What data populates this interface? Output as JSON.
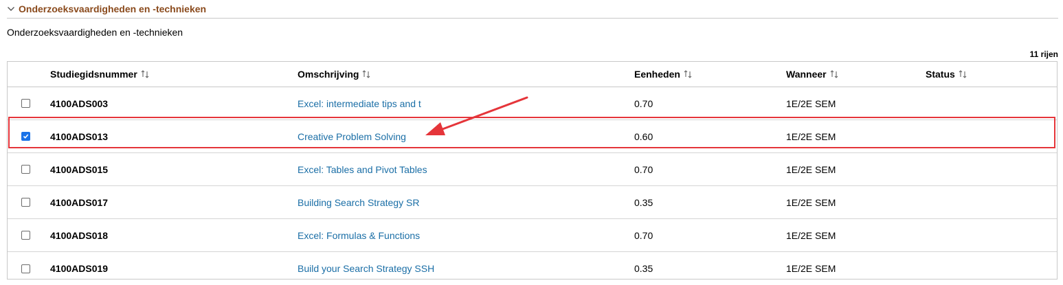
{
  "section": {
    "title": "Onderzoeksvaardigheden en -technieken",
    "subtitle": "Onderzoeksvaardigheden en -technieken"
  },
  "row_count": "11 rijen",
  "columns": {
    "id": "Studiegidsnummer",
    "description": "Omschrijving",
    "units": "Eenheden",
    "when": "Wanneer",
    "status": "Status"
  },
  "rows": [
    {
      "checked": false,
      "id": "4100ADS003",
      "description": "Excel: intermediate tips and t",
      "units": "0.70",
      "when": "1E/2E SEM",
      "status": ""
    },
    {
      "checked": true,
      "id": "4100ADS013",
      "description": "Creative Problem Solving",
      "units": "0.60",
      "when": "1E/2E SEM",
      "status": ""
    },
    {
      "checked": false,
      "id": "4100ADS015",
      "description": "Excel: Tables and Pivot Tables",
      "units": "0.70",
      "when": "1E/2E SEM",
      "status": ""
    },
    {
      "checked": false,
      "id": "4100ADS017",
      "description": "Building Search Strategy SR",
      "units": "0.35",
      "when": "1E/2E SEM",
      "status": ""
    },
    {
      "checked": false,
      "id": "4100ADS018",
      "description": "Excel: Formulas & Functions",
      "units": "0.70",
      "when": "1E/2E SEM",
      "status": ""
    },
    {
      "checked": false,
      "id": "4100ADS019",
      "description": "Build your Search Strategy SSH",
      "units": "0.35",
      "when": "1E/2E SEM",
      "status": ""
    }
  ],
  "colors": {
    "section_title": "#8a4a1c",
    "link": "#1a6ea6",
    "checkbox_checked": "#1a73e8",
    "annotation": "#e5353a"
  },
  "icons": {
    "collapse": "chevron-down-icon",
    "sort": "sort-arrows-icon",
    "annotation_arrow": "arrow-icon"
  }
}
